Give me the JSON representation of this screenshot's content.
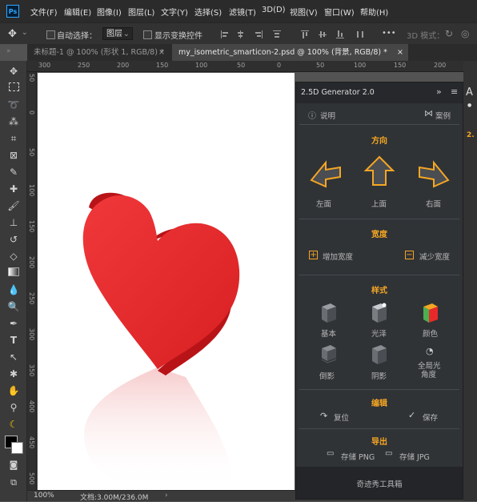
{
  "menubar": {
    "logo": "Ps",
    "items": [
      "文件(F)",
      "编辑(E)",
      "图像(I)",
      "图层(L)",
      "文字(Y)",
      "选择(S)",
      "滤镜(T)",
      "3D(D)",
      "视图(V)",
      "窗口(W)",
      "帮助(H)"
    ]
  },
  "options": {
    "auto_select": "自动选择：",
    "layer_select": "图层",
    "show_transform": "显示变换控件",
    "more": "•••",
    "mode_3d": "3D 模式："
  },
  "tabs": [
    {
      "label": "未标题-1 @ 100% (形状 1, RGB/8) *",
      "close": "×"
    },
    {
      "label": "my_isometric_smarticon-2.psd @ 100% (背景, RGB/8) *",
      "close": "×"
    }
  ],
  "ruler_top": [
    "300",
    "250",
    "200",
    "150",
    "100",
    "50",
    "0",
    "50",
    "100",
    "150",
    "200"
  ],
  "ruler_left": [
    "50",
    "0",
    "50",
    "100",
    "150",
    "200",
    "250",
    "300",
    "350",
    "400",
    "450",
    "500"
  ],
  "status": {
    "zoom": "100%",
    "doc": "文档:3.00M/236.0M"
  },
  "panel": {
    "title": "2.5D Generator 2.0",
    "collapse": "»",
    "menu": "≡",
    "help": "说明",
    "cases": "案例",
    "direction_title": "方向",
    "left_face": "左面",
    "top_face": "上面",
    "right_face": "右面",
    "width_title": "宽度",
    "add_width": "增加宽度",
    "reduce_width": "减少宽度",
    "style_title": "样式",
    "basic": "基本",
    "gloss": "光泽",
    "color": "颜色",
    "inverted_shadow": "倒影",
    "shadow": "阴影",
    "global_light_1": "全局光",
    "global_light_2": "角度",
    "edit_title": "编辑",
    "reset": "复位",
    "save": "保存",
    "export_title": "导出",
    "save_png": "存储 PNG",
    "save_jpg": "存储 JPG",
    "footer": "奇迹秀工具箱"
  },
  "colors": {
    "accent": "#f5a623",
    "heart": "#e8292a"
  }
}
